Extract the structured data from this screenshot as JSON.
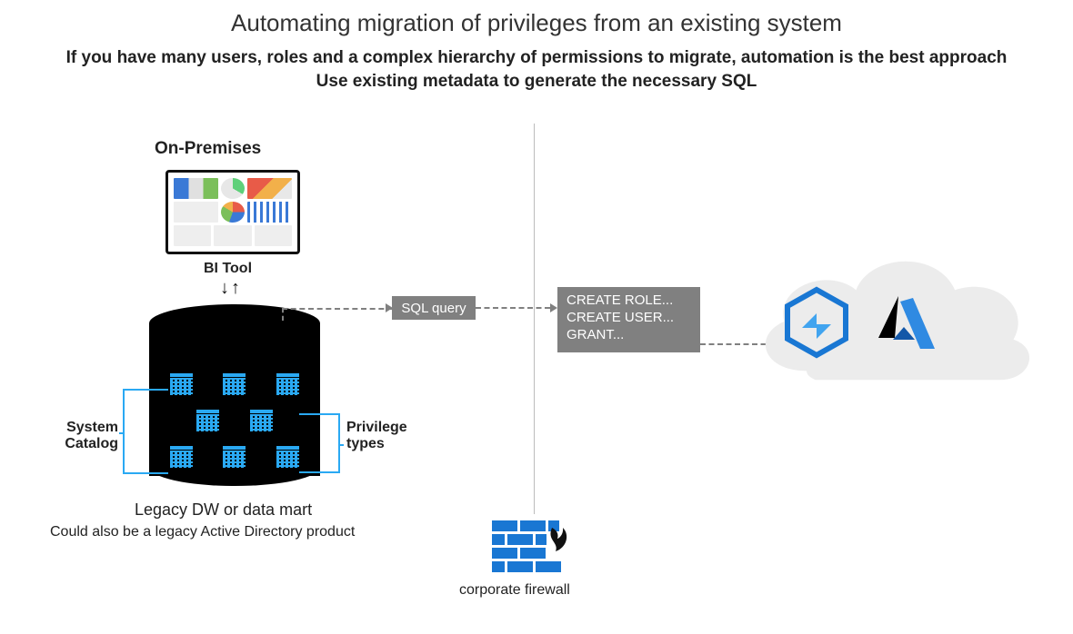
{
  "title": "Automating migration of privileges from an existing system",
  "subtitle1": "If you have many users, roles and a complex hierarchy of permissions to migrate, automation is the best approach",
  "subtitle2": "Use existing metadata to generate the necessary SQL",
  "left": {
    "heading": "On-Premises",
    "bi_label": "BI Tool",
    "db_label": "Legacy DW or data mart",
    "db_sublabel": "Could also be a legacy Active Directory product",
    "callout_left": "System Catalog",
    "callout_right": "Privilege types"
  },
  "flow": {
    "sql_query": "SQL query",
    "commands": [
      "CREATE ROLE...",
      "CREATE USER...",
      "GRANT..."
    ]
  },
  "firewall": {
    "label": "corporate firewall"
  }
}
